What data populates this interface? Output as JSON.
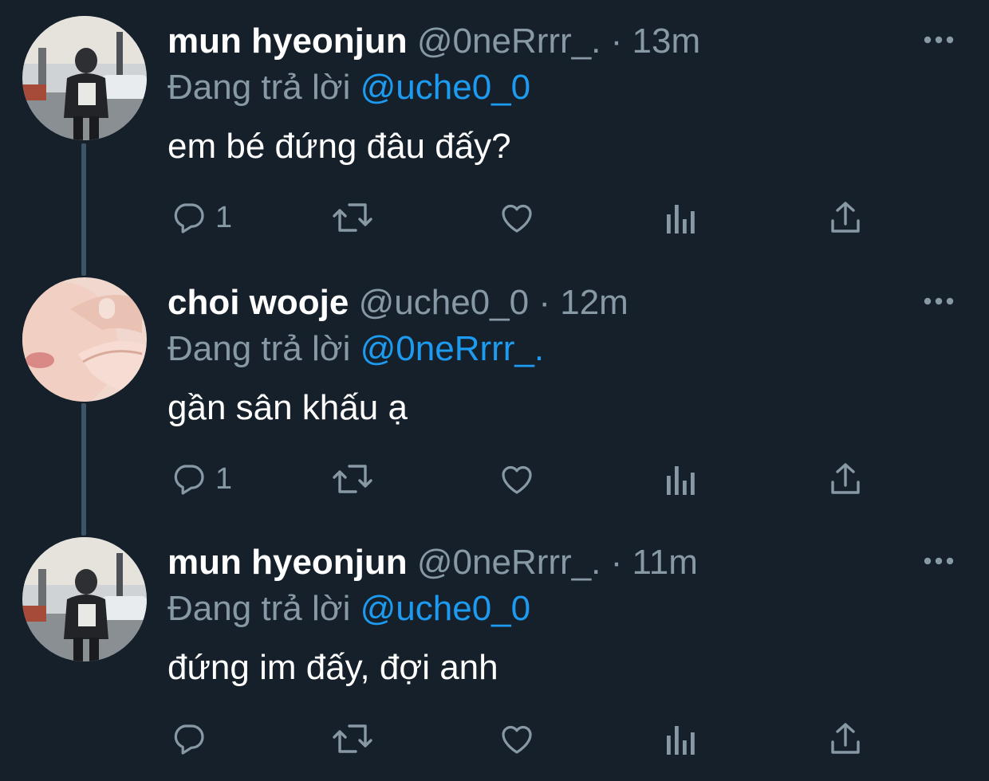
{
  "thread": {
    "tweets": [
      {
        "name": "mun hyeonjun",
        "handle": "@0neRrrr_.",
        "separator": "·",
        "time": "13m",
        "replying_prefix": "Đang trả lời",
        "replying_to": "@uche0_0",
        "text": "em bé đứng đâu đấy?",
        "reply_count": "1",
        "avatar_icon": "profile-photo-person-street"
      },
      {
        "name": "choi wooje",
        "handle": "@uche0_0",
        "separator": "·",
        "time": "12m",
        "replying_prefix": "Đang trả lời",
        "replying_to": "@0neRrrr_.",
        "text": "gần sân khấu ạ",
        "reply_count": "1",
        "avatar_icon": "profile-photo-closeup-face"
      },
      {
        "name": "mun hyeonjun",
        "handle": "@0neRrrr_.",
        "separator": "·",
        "time": "11m",
        "replying_prefix": "Đang trả lời",
        "replying_to": "@uche0_0",
        "text": "đứng im đấy, đợi anh",
        "reply_count": "",
        "avatar_icon": "profile-photo-person-street"
      }
    ]
  },
  "colors": {
    "background": "#15202b",
    "primary_text": "#ffffff",
    "secondary_text": "#8899a6",
    "link": "#1d9bf0",
    "thread_line": "#3d5466"
  },
  "icons": [
    "reply-icon",
    "retweet-icon",
    "like-icon",
    "analytics-icon",
    "share-icon",
    "more-icon"
  ]
}
